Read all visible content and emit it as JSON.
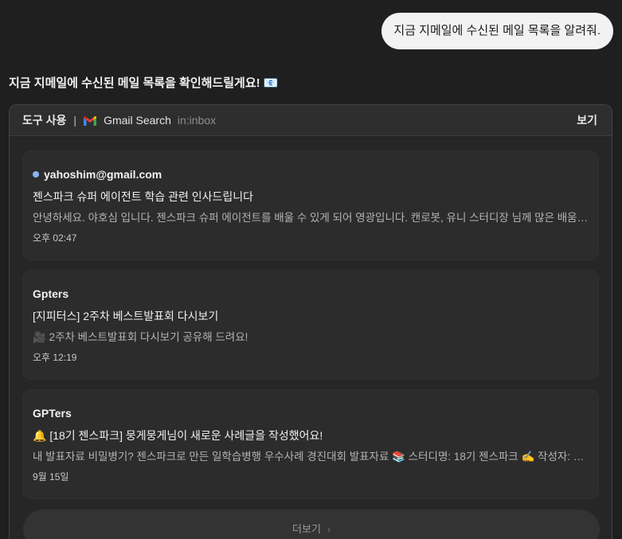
{
  "user_message": "지금 지메일에 수신된 메일 목록을 알려줘.",
  "assistant": {
    "text": "지금 지메일에 수신된 메일 목록을 확인해드릴게요!",
    "emoji": "📧"
  },
  "tool": {
    "label": "도구 사용",
    "separator": "|",
    "name": "Gmail Search",
    "query": "in:inbox",
    "view_label": "보기",
    "icon": "gmail-logo"
  },
  "emails": [
    {
      "sender": "yahoshim@gmail.com",
      "unread": true,
      "subject": "젠스파크 슈퍼 에이전트 학습 관련 인사드립니다",
      "snippet": "안녕하세요. 야호심 입니다. 젠스파크 슈퍼 에이전트를 배울 수 있게 되어 영광입니다. 캔로봇, 유니 스터디장 님께 많은 배움을…",
      "time": "오후 02:47"
    },
    {
      "sender": "Gpters",
      "unread": false,
      "subject": "[지피터스] 2주차 베스트발표회 다시보기",
      "snippet": "🎥 2주차 베스트발표회 다시보기 공유해 드려요!",
      "time": "오후 12:19"
    },
    {
      "sender": "GPTers",
      "unread": false,
      "subject": "🔔 [18기 젠스파크] 뭉게뭉게님이 새로운 사례글을 작성했어요!",
      "snippet": "내 발표자료 비밀병기? 젠스파크로 만든 일학습병행 우수사례 경진대회 발표자료 📚 스터디명: 18기 젠스파크 ✍️ 작성자: 뭉…",
      "time": "9월 15일"
    }
  ],
  "more_label": "더보기",
  "colors": {
    "background": "#1f1f1f",
    "panel": "#262626",
    "card": "#2c2c2c",
    "unread_dot": "#8ab4f8",
    "user_bubble": "#f2f2f2"
  }
}
